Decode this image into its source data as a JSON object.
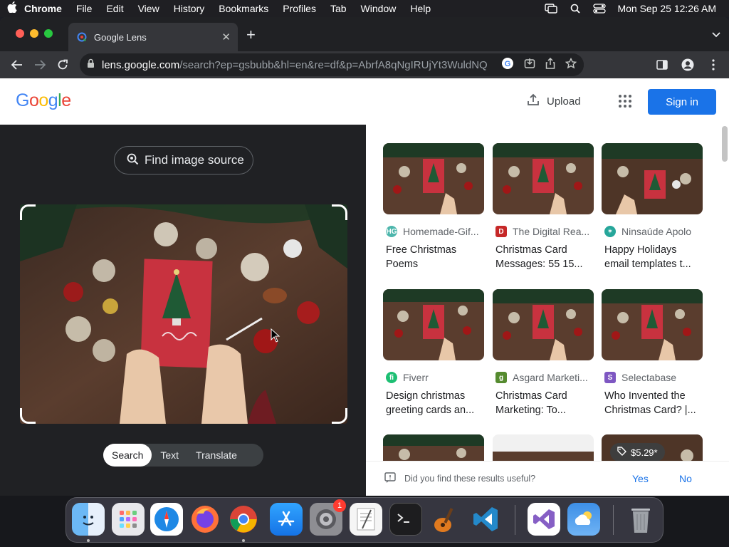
{
  "menubar": {
    "app_name": "Chrome",
    "items": [
      "File",
      "Edit",
      "View",
      "History",
      "Bookmarks",
      "Profiles",
      "Tab",
      "Window",
      "Help"
    ],
    "datetime": "Mon Sep 25  12:26 AM"
  },
  "browser": {
    "tab_title": "Google Lens",
    "url_domain": "lens.google.com",
    "url_path": "/search?ep=gsbubb&hl=en&re=df&p=AbrfA8qNgIRUjYt3WuldNQVm3N58aOri..."
  },
  "header": {
    "logo": "Google",
    "upload_label": "Upload",
    "signin_label": "Sign in"
  },
  "left": {
    "find_source_label": "Find image source",
    "modes": [
      "Search",
      "Text",
      "Translate"
    ],
    "active_mode": "Search"
  },
  "results": [
    {
      "source": "Homemade-Gif...",
      "title": "Free Christmas Poems",
      "icon_color": "#4db6ac",
      "icon_text": "HG"
    },
    {
      "source": "The Digital Rea...",
      "title": "Christmas Card Messages: 55 15...",
      "icon_color": "#c62828",
      "icon_text": "D"
    },
    {
      "source": "Ninsaúde Apolo",
      "title": "Happy Holidays email templates t...",
      "icon_color": "#26a69a",
      "icon_text": "✶"
    },
    {
      "source": "Fiverr",
      "title": "Design christmas greeting cards an...",
      "icon_color": "#1dbf73",
      "icon_text": "fi"
    },
    {
      "source": "Asgard Marketi...",
      "title": "Christmas Card Marketing: To...",
      "icon_color": "#558b2f",
      "icon_text": "g"
    },
    {
      "source": "Selectabase",
      "title": "Who Invented the Christmas Card? |...",
      "icon_color": "#7e57c2",
      "icon_text": "S"
    }
  ],
  "price_chip": "$5.29*",
  "feedback": {
    "question": "Did you find these results useful?",
    "yes": "Yes",
    "no": "No"
  },
  "dock": {
    "notification_badge": "1",
    "apps": [
      "finder-icon",
      "launchpad-icon",
      "safari-icon",
      "firefox-icon",
      "chrome-icon",
      "app-store-icon",
      "system-settings-icon",
      "textedit-icon",
      "terminal-icon",
      "garageband-icon",
      "vscode-icon",
      "visual-studio-icon",
      "weather-icon",
      "trash-icon"
    ]
  }
}
